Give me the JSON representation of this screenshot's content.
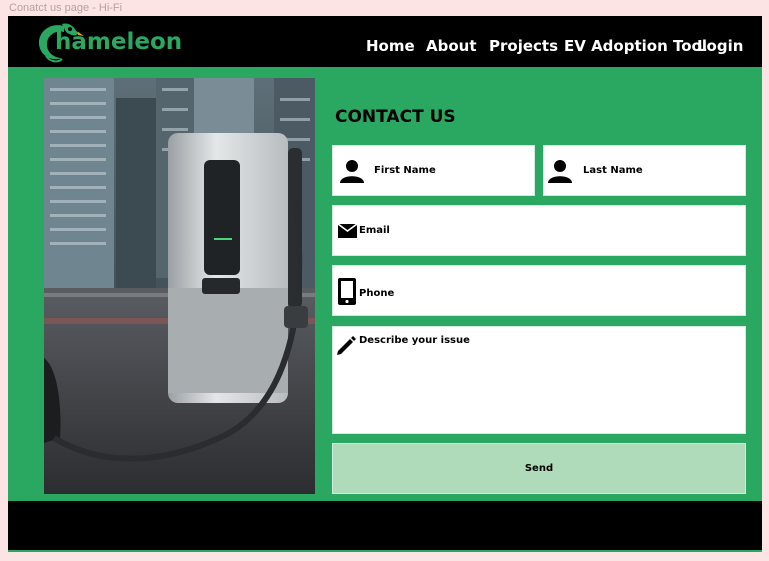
{
  "frame_label": "Conatct us page - Hi-Fi",
  "brand": {
    "name": "hameleon",
    "color": "#2aa760"
  },
  "nav": {
    "home": "Home",
    "about": "About",
    "projects": "Projects",
    "ev_tool": "EV Adoption Tool",
    "login": "Login"
  },
  "contact": {
    "title": "CONTACT US",
    "first_name": "First Name",
    "last_name": "Last Name",
    "email": "Email",
    "phone": "Phone",
    "issue": "Describe your issue",
    "send": "Send"
  },
  "colors": {
    "accent": "#2aa760",
    "send_bg": "#b0dbbb",
    "header_bg": "#000000"
  }
}
